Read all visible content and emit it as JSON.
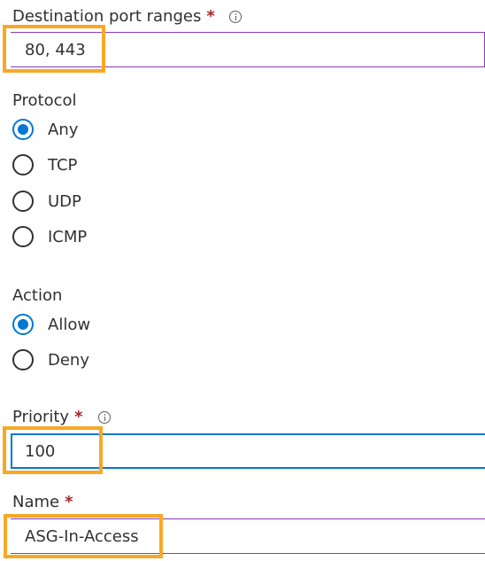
{
  "colors": {
    "accent": "#0078d4",
    "required_star": "#a4262c",
    "field_border_purple": "#8a3ab9",
    "highlight_orange": "#f9a825"
  },
  "dest_ports": {
    "label": "Destination port ranges",
    "required_mark": "*",
    "info_icon": "info-icon",
    "value": "80, 443"
  },
  "protocol": {
    "label": "Protocol",
    "options": [
      "Any",
      "TCP",
      "UDP",
      "ICMP"
    ],
    "selected": "Any"
  },
  "action": {
    "label": "Action",
    "options": [
      "Allow",
      "Deny"
    ],
    "selected": "Allow"
  },
  "priority": {
    "label": "Priority",
    "required_mark": "*",
    "info_icon": "info-icon",
    "value": "100"
  },
  "name": {
    "label": "Name",
    "required_mark": "*",
    "value": "ASG-In-Access"
  }
}
